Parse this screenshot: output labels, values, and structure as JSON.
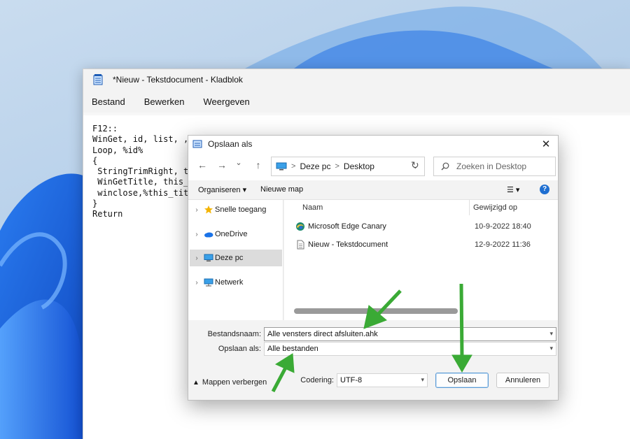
{
  "notepad": {
    "title": "*Nieuw - Tekstdocument - Kladblok",
    "menu": [
      "Bestand",
      "Bewerken",
      "Weergeven"
    ],
    "content": "F12::\nWinGet, id, list, , , ProgramM\nLoop, %id%\n{\n StringTrimRight, this_id, id%A_Index%\n WinGetTitle, this_title, ahk_id %this_id%\n winclose,%this_title%\n}\nReturn"
  },
  "dialog": {
    "title": "Opslaan als",
    "close": "✕",
    "nav": {
      "back": "←",
      "forward": "→",
      "dropdown": "⌄",
      "up": "↑"
    },
    "address": {
      "crumbs": [
        "Deze pc",
        "Desktop"
      ],
      "separator": ">",
      "dropdown": "⌄"
    },
    "refresh": "↻",
    "search_placeholder": "Zoeken in Desktop",
    "toolbar": {
      "organize": "Organiseren ▾",
      "new_folder": "Nieuwe map",
      "view": "☰ ▾",
      "help": "?"
    },
    "tree": [
      {
        "label": "Snelle toegang",
        "icon": "star-icon"
      },
      {
        "label": "OneDrive",
        "icon": "cloud-icon"
      },
      {
        "label": "Deze pc",
        "icon": "pc-icon"
      },
      {
        "label": "Netwerk",
        "icon": "network-icon"
      }
    ],
    "columns": {
      "name": "Naam",
      "modified": "Gewijzigd op"
    },
    "files": [
      {
        "name": "Microsoft Edge Canary",
        "modified": "10-9-2022 18:40",
        "icon": "edge-canary-icon"
      },
      {
        "name": "Nieuw - Tekstdocument",
        "modified": "12-9-2022 11:36",
        "icon": "text-file-icon"
      }
    ],
    "filename_label": "Bestandsnaam:",
    "filename_value": "Alle vensters direct afsluiten.ahk",
    "savetype_label": "Opslaan als:",
    "savetype_value": "Alle bestanden",
    "hide_folders": "Mappen verbergen",
    "encoding_label": "Codering:",
    "encoding_value": "UTF-8",
    "save_button": "Opslaan",
    "cancel_button": "Annuleren"
  },
  "colors": {
    "accent": "#1f6fd1",
    "arrow": "#3aaa35"
  }
}
